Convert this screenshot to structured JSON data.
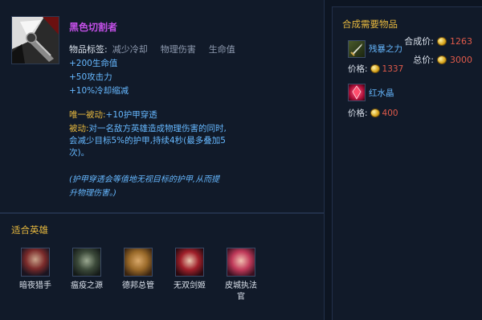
{
  "item": {
    "name": "黑色切割者",
    "tags_label": "物品标签:",
    "tags": [
      "减少冷却",
      "物理伤害",
      "生命值"
    ],
    "combine_label": "合成价:",
    "combine_price": "1263",
    "total_label": "总价:",
    "total_price": "3000",
    "stats": [
      "+200生命值",
      "+50攻击力",
      "+10%冷却缩减"
    ],
    "unique_passive_label": "唯一被动:",
    "unique_passive_text": "+10护甲穿透",
    "passive_label": "被动:",
    "passive_text_1": "对一名敌方英雄造成物理伤害的同时,",
    "passive_text_2": "会减少目标5%的护甲,持续4秒(最多叠加5",
    "passive_text_3": "次)。",
    "note_1": "(护甲穿透会等值地无视目标的护甲,从而提",
    "note_2": "升物理伤害。)"
  },
  "recipe": {
    "title": "合成需要物品",
    "items": [
      {
        "name": "残暴之力",
        "price_label": "价格:",
        "price": "1337"
      },
      {
        "name": "红水晶",
        "price_label": "价格:",
        "price": "400"
      }
    ]
  },
  "heroes": {
    "title": "适合英雄",
    "list": [
      {
        "name": "暗夜猎手",
        "name2": ""
      },
      {
        "name": "瘟疫之源",
        "name2": ""
      },
      {
        "name": "德邦总管",
        "name2": ""
      },
      {
        "name": "无双剑姬",
        "name2": ""
      },
      {
        "name": "皮城执法",
        "name2": "官"
      }
    ]
  },
  "colors": {
    "item_name": "#c24fe6",
    "section_title": "#e6b83e",
    "stat_text": "#66b8ff",
    "price_value": "#e05a4a"
  }
}
